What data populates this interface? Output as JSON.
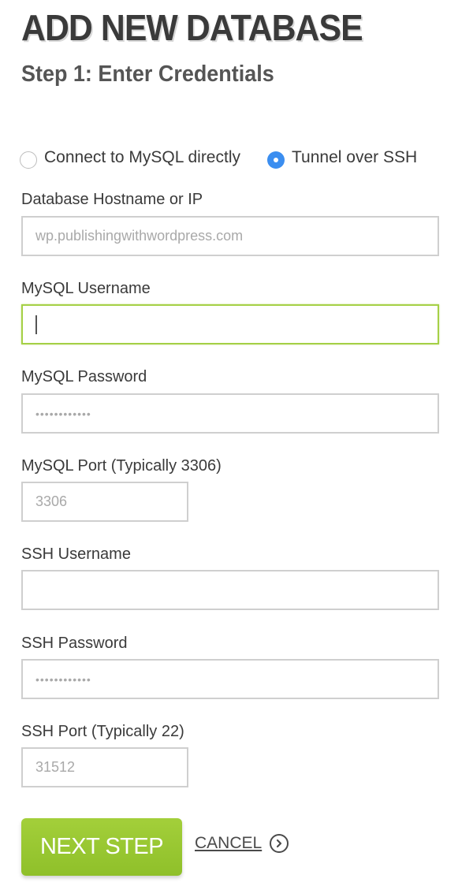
{
  "header": {
    "title": "ADD NEW DATABASE",
    "step": "Step 1: Enter Credentials"
  },
  "connection": {
    "options": [
      {
        "label": "Connect to MySQL directly",
        "selected": false
      },
      {
        "label": "Tunnel over SSH",
        "selected": true
      }
    ]
  },
  "fields": {
    "hostname": {
      "label": "Database Hostname or IP",
      "value": "wp.publishingwithwordpress.com"
    },
    "mysql_username": {
      "label": "MySQL Username",
      "value": ""
    },
    "mysql_password": {
      "label": "MySQL Password",
      "value": "••••••••••••"
    },
    "mysql_port": {
      "label": "MySQL Port (Typically 3306)",
      "value": "3306"
    },
    "ssh_username": {
      "label": "SSH Username",
      "value": ""
    },
    "ssh_password": {
      "label": "SSH Password",
      "value": "••••••••••••"
    },
    "ssh_port": {
      "label": "SSH Port (Typically 22)",
      "value": "31512"
    }
  },
  "actions": {
    "next_label": "NEXT STEP",
    "cancel_label": "CANCEL",
    "cancel_icon": "chevron-right-circle-icon"
  },
  "colors": {
    "accent_green": "#9acb34",
    "radio_blue": "#3b8ef0",
    "focus_border": "#a5d046"
  }
}
